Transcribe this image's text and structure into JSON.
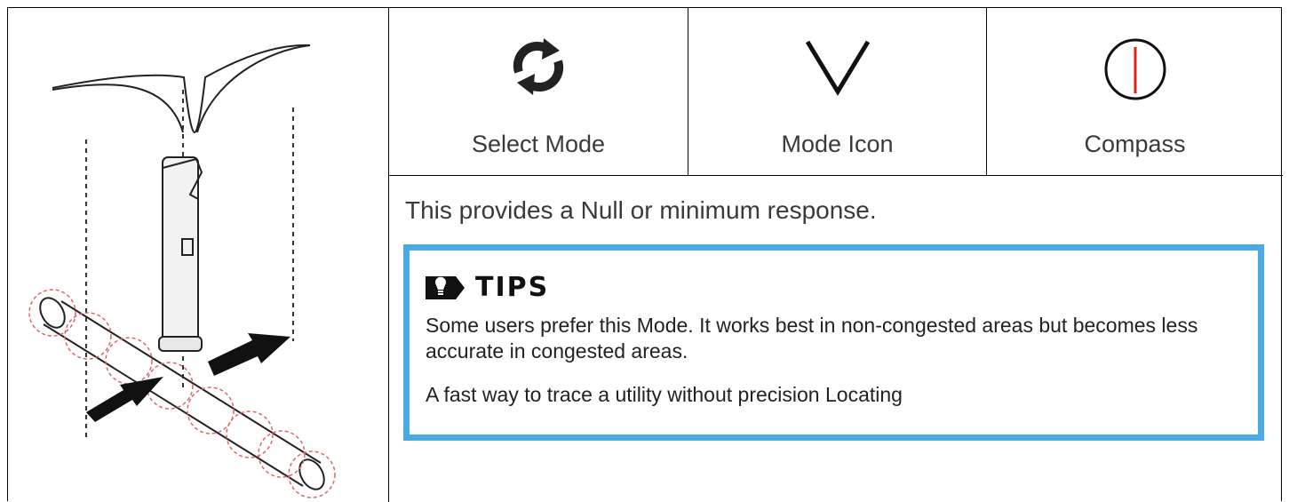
{
  "illustration": {
    "icon": "locator-over-pipe-illustration"
  },
  "modes": [
    {
      "label": "Select Mode",
      "icon": "refresh-cycle-icon"
    },
    {
      "label": "Mode Icon",
      "icon": "null-v-icon"
    },
    {
      "label": "Compass",
      "icon": "compass-icon",
      "accent": "#e2231a"
    }
  ],
  "description": "This provides a Null or minimum response.",
  "tips": {
    "title": "TIPS",
    "icon": "lightbulb-icon",
    "border_color": "#4aaae3",
    "paragraph1": "Some users prefer this Mode. It works best in non-congested areas but becomes less accurate in congested areas.",
    "paragraph2": "A fast way to trace a utility without precision Locating"
  }
}
